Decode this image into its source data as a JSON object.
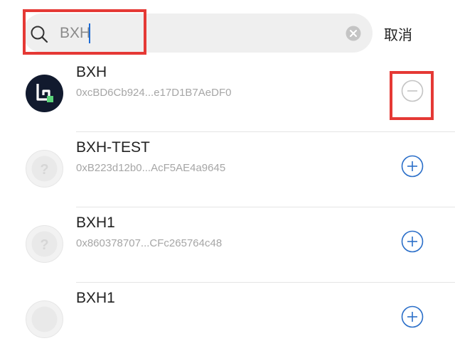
{
  "search": {
    "value": "BXH",
    "cancel_label": "取消"
  },
  "tokens": [
    {
      "name": "BXH",
      "address": "0xcBD6Cb924...e17D1B7AeDF0",
      "action": "remove",
      "logo": "bxh-logo"
    },
    {
      "name": "BXH-TEST",
      "address": "0xB223d12b0...AcF5AE4a9645",
      "action": "add",
      "logo": "unknown-token-icon"
    },
    {
      "name": "BXH1",
      "address": "0x860378707...CFc265764c48",
      "action": "add",
      "logo": "unknown-token-icon"
    },
    {
      "name": "BXH1",
      "address": "",
      "action": "add",
      "logo": "unknown-token-icon"
    }
  ],
  "colors": {
    "highlight": "#e53935",
    "add_icon": "#2b6fc9",
    "remove_icon": "#bdbdbd",
    "caret": "#1d6cd6"
  }
}
